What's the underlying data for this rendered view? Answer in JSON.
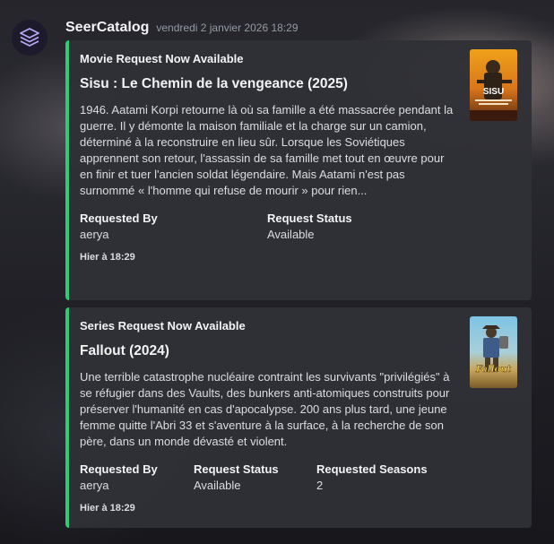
{
  "message": {
    "username": "SeerCatalog",
    "timestamp": "vendredi 2 janvier 2026 18:29",
    "avatar_icon": "layers-stack-icon",
    "accent_color": "#2fcd72"
  },
  "embeds": [
    {
      "author": "Movie Request Now Available",
      "title": "Sisu : Le Chemin de la vengeance (2025)",
      "description": "1946. Aatami Korpi retourne là où sa famille a été massacrée pendant la guerre. Il y démonte la maison familiale et la charge sur un camion, déterminé à la reconstruire en lieu sûr. Lorsque les Soviétiques apprennent son retour, l'assassin de sa famille met tout en œuvre pour en finir et tuer l'ancien soldat légendaire. Mais Aatami n'est pas surnommé « l'homme qui refuse de mourir » pour rien...",
      "thumbnail": {
        "poster_text": "SISU"
      },
      "fields": [
        {
          "name": "Requested By",
          "value": "aerya"
        },
        {
          "name": "Request Status",
          "value": "Available"
        }
      ],
      "footer": "Hier à 18:29"
    },
    {
      "author": "Series Request Now Available",
      "title": "Fallout (2024)",
      "description": "Une terrible catastrophe nucléaire contraint les survivants \"privilégiés\" à se réfugier dans des Vaults, des bunkers anti-atomiques construits pour préserver l'humanité en cas d'apocalypse. 200 ans plus tard, une jeune femme quitte l'Abri 33 et s'aventure à la surface, à la recherche de son père, dans un monde dévasté et violent.",
      "thumbnail": {
        "poster_text": "Fallout"
      },
      "fields": [
        {
          "name": "Requested By",
          "value": "aerya"
        },
        {
          "name": "Request Status",
          "value": "Available"
        },
        {
          "name": "Requested Seasons",
          "value": "2"
        }
      ],
      "footer": "Hier à 18:29"
    }
  ]
}
